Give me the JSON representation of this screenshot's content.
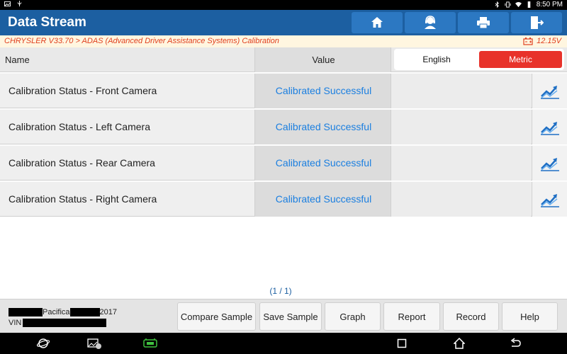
{
  "status_bar": {
    "time": "8:50 PM"
  },
  "header": {
    "title": "Data Stream",
    "buttons": [
      "home-icon",
      "support-icon",
      "print-icon",
      "exit-icon"
    ]
  },
  "breadcrumb": {
    "path": "CHRYSLER V33.70 > ADAS (Advanced Driver Assistance Systems) Calibration",
    "voltage": "12.15V"
  },
  "table": {
    "col_name": "Name",
    "col_value": "Value",
    "unit_toggle": {
      "english": "English",
      "metric": "Metric",
      "selected": "Metric"
    },
    "rows": [
      {
        "name": "Calibration Status - Front Camera",
        "value": "Calibrated Successful",
        "unit": ""
      },
      {
        "name": "Calibration Status - Left Camera",
        "value": "Calibrated Successful",
        "unit": ""
      },
      {
        "name": "Calibration Status - Rear Camera",
        "value": "Calibrated Successful",
        "unit": ""
      },
      {
        "name": "Calibration Status - Right Camera",
        "value": "Calibrated Successful",
        "unit": ""
      }
    ]
  },
  "pagination": "(1 / 1)",
  "vehicle": {
    "model": "Pacifica",
    "year": "2017",
    "vin_label": "VIN"
  },
  "toolbar": {
    "compare_sample": "Compare Sample",
    "save_sample": "Save Sample",
    "graph": "Graph",
    "report": "Report",
    "record": "Record",
    "help": "Help"
  },
  "colors": {
    "title_bar": "#1c5fa1",
    "accent_red": "#e8322a",
    "value_blue": "#1b7fe0",
    "breadcrumb_text": "#e0401f"
  }
}
